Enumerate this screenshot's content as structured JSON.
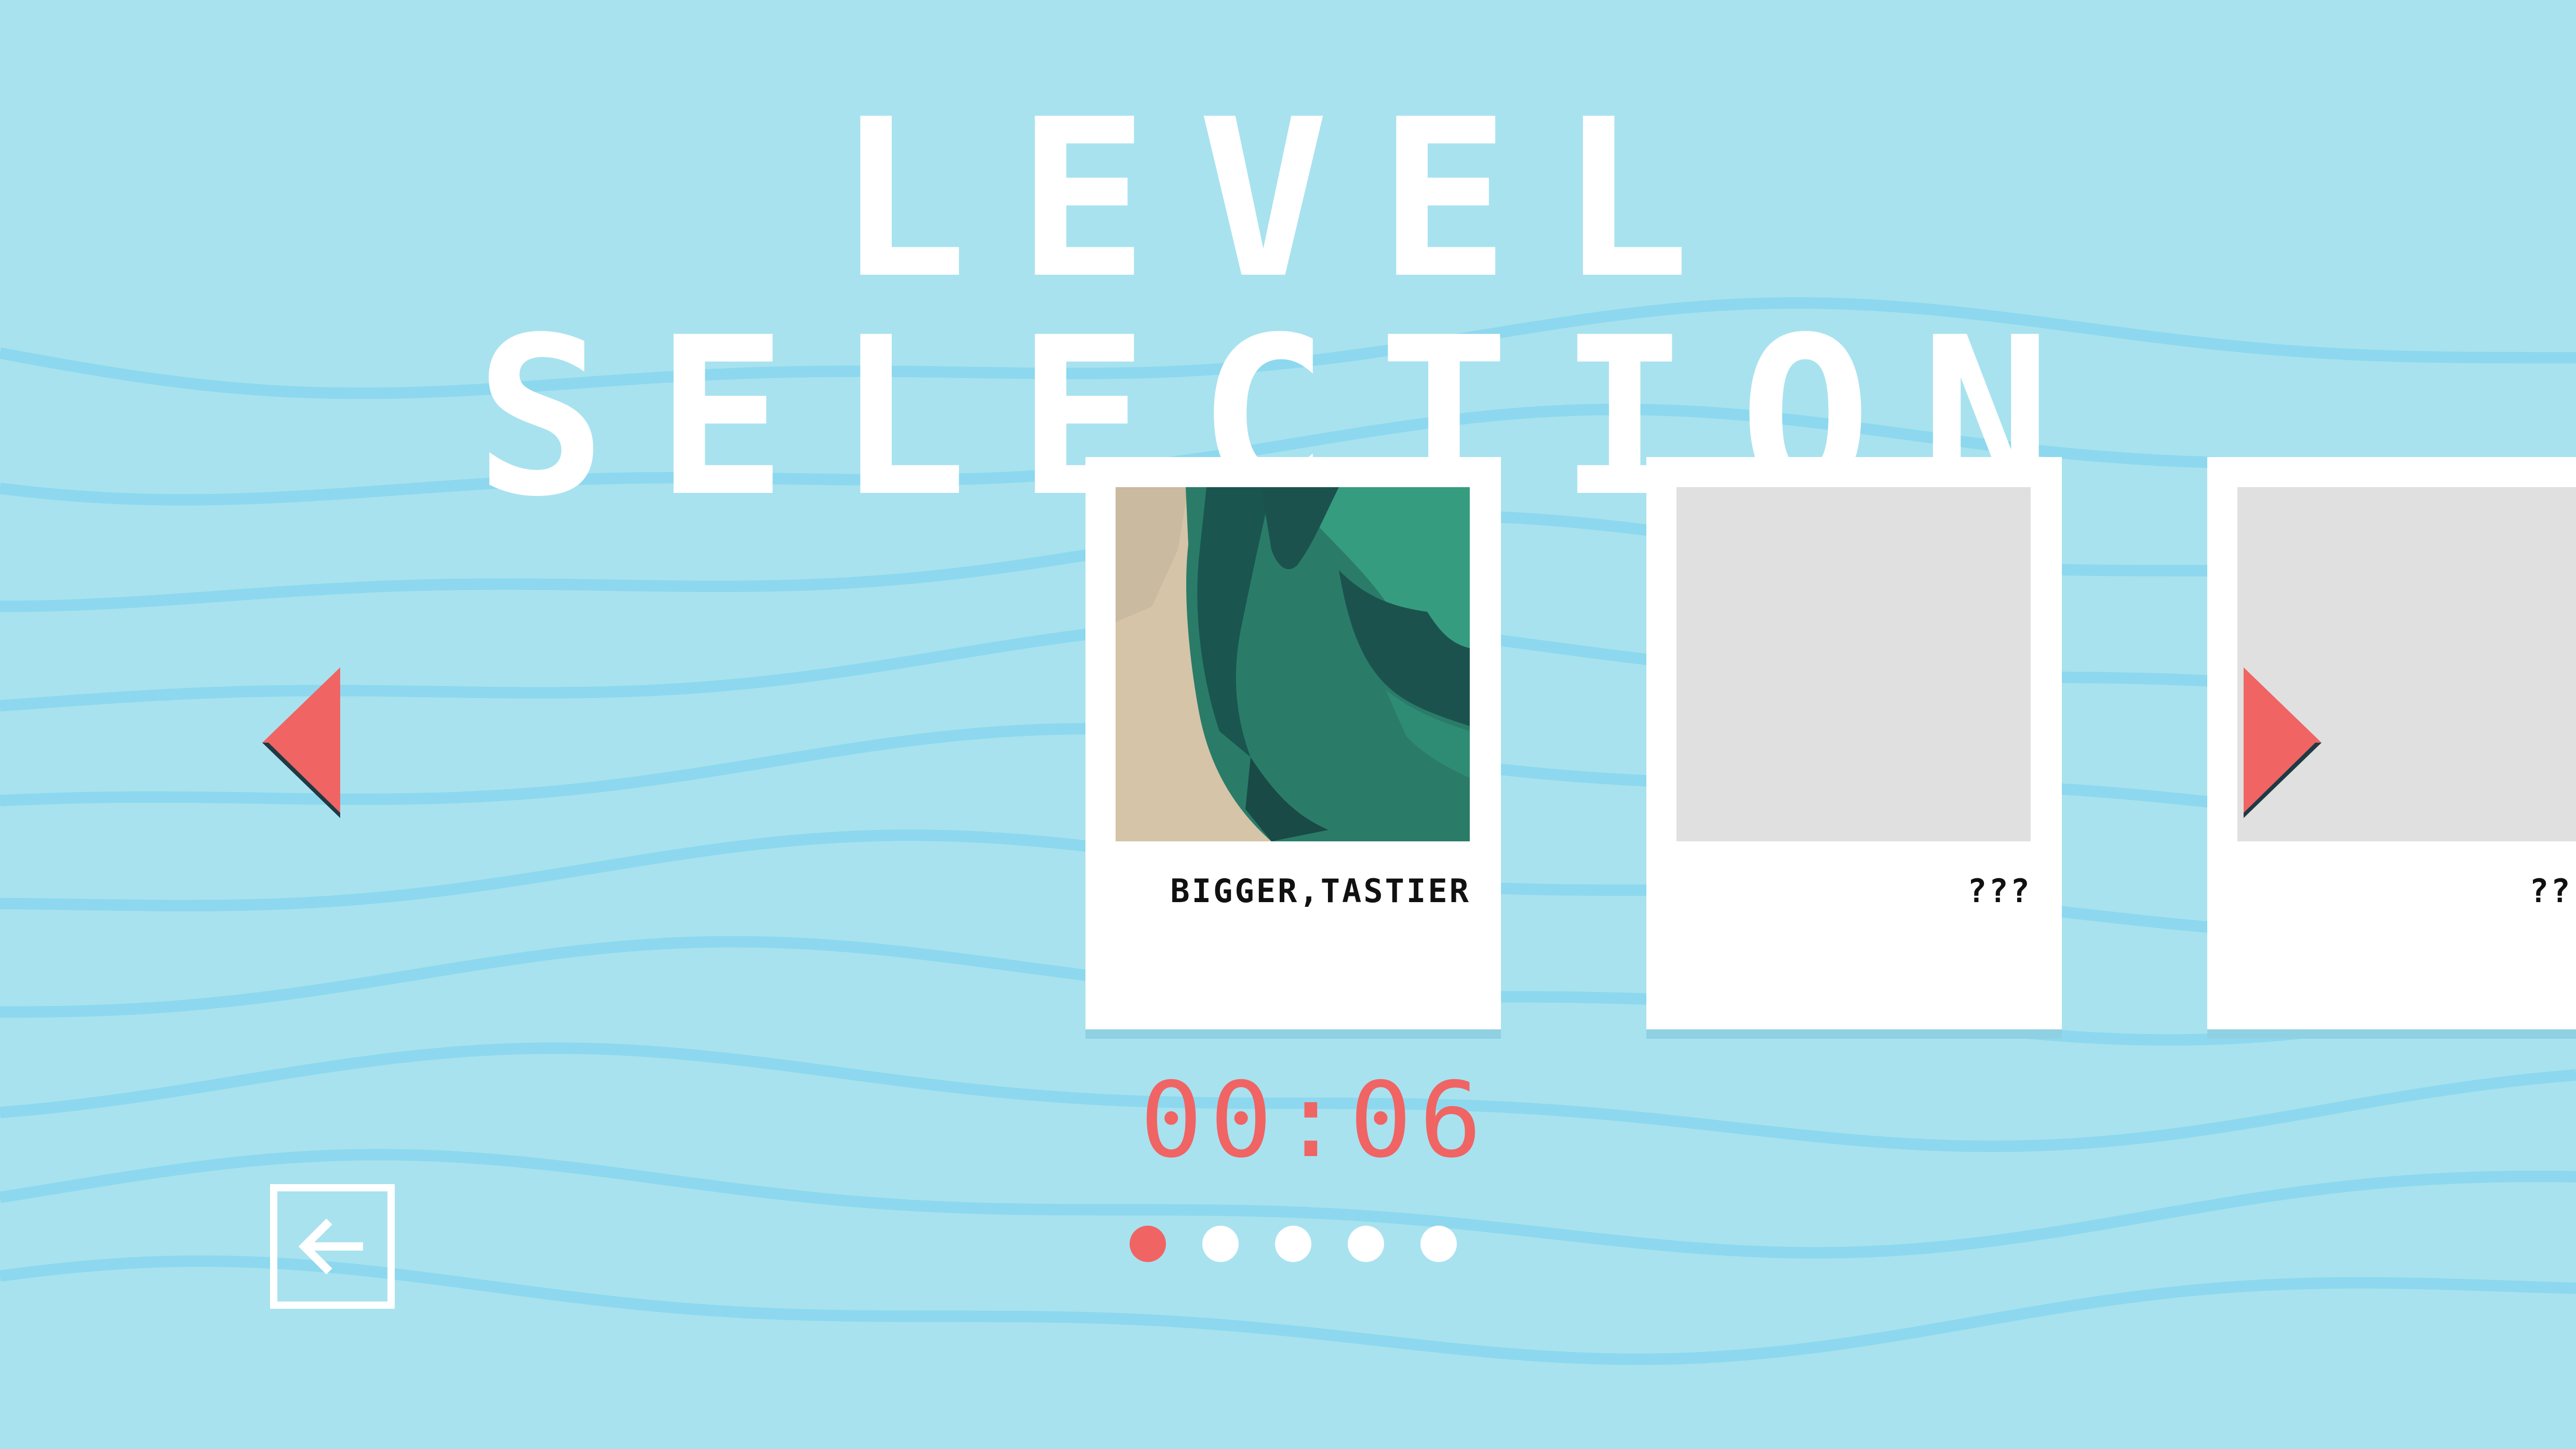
{
  "screen": {
    "title": "LEVEL SELECTION",
    "background_color": "#a8e2ef",
    "wave_color": "#8dd8ee"
  },
  "levels": [
    {
      "label": "BIGGER,TASTIER",
      "unlocked": true,
      "thumbnail": "leaf-on-sand"
    },
    {
      "label": "???",
      "unlocked": false,
      "thumbnail": "locked-gray"
    },
    {
      "label": "??",
      "unlocked": false,
      "thumbnail": "locked-gray"
    }
  ],
  "timer": {
    "value": "00:06",
    "color": "#f06464"
  },
  "pagination": {
    "total": 5,
    "current": 1
  },
  "navigation": {
    "prev_icon": "triangle-left-icon",
    "next_icon": "triangle-right-icon",
    "back_icon": "arrow-left-icon",
    "accent_color": "#f06464"
  }
}
